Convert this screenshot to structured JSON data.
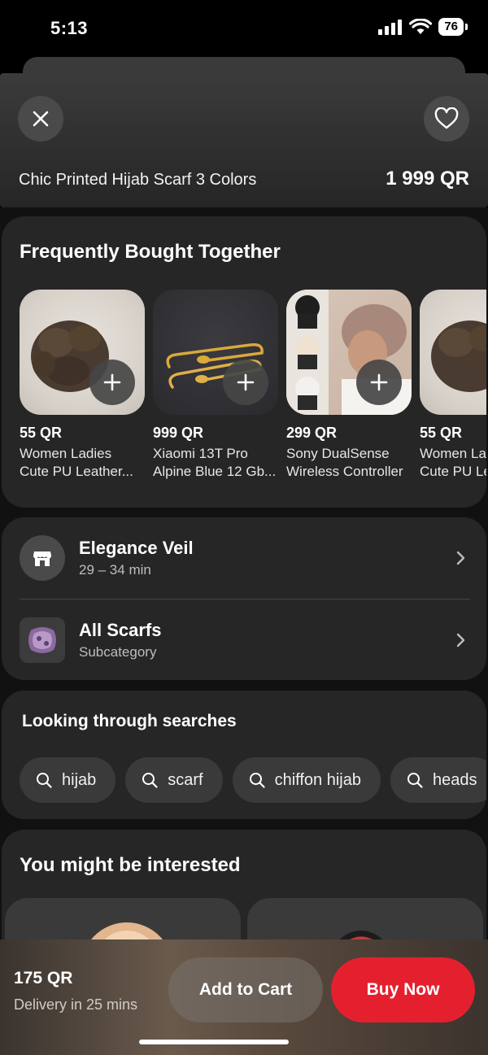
{
  "status_bar": {
    "time": "5:13",
    "battery": "76"
  },
  "header": {
    "product_title": "Chic Printed Hijab Scarf 3 Colors",
    "price": "1 999 QR",
    "close_icon": "close-icon",
    "favorite_icon": "heart-icon"
  },
  "frequently_bought": {
    "title": "Frequently Bought Together",
    "items": [
      {
        "price": "55 QR",
        "name_line1": "Women Ladies",
        "name_line2": "Cute PU Leather..."
      },
      {
        "price": "999 QR",
        "name_line1": "Xiaomi 13T Pro",
        "name_line2": "Alpine Blue 12 Gb..."
      },
      {
        "price": "299 QR",
        "name_line1": "Sony DualSense",
        "name_line2": "Wireless Controller"
      },
      {
        "price": "55 QR",
        "name_line1": "Women La",
        "name_line2": "Cute PU Le"
      }
    ]
  },
  "store": {
    "name": "Elegance Veil",
    "delivery_time": "29 – 34 min",
    "icon": "store-icon"
  },
  "category": {
    "name": "All Scarfs",
    "label": "Subcategory"
  },
  "searches": {
    "title": "Looking through searches",
    "chips": [
      "hijab",
      "scarf",
      "chiffon hijab",
      "heads"
    ]
  },
  "recommendations": {
    "title": "You might be interested"
  },
  "bottom_bar": {
    "price": "175 QR",
    "delivery": "Delivery in 25 mins",
    "add_to_cart": "Add to Cart",
    "buy_now": "Buy Now"
  },
  "colors": {
    "accent_red": "#e5202e",
    "card_bg": "#262626",
    "chip_bg": "#3a3a3a"
  }
}
